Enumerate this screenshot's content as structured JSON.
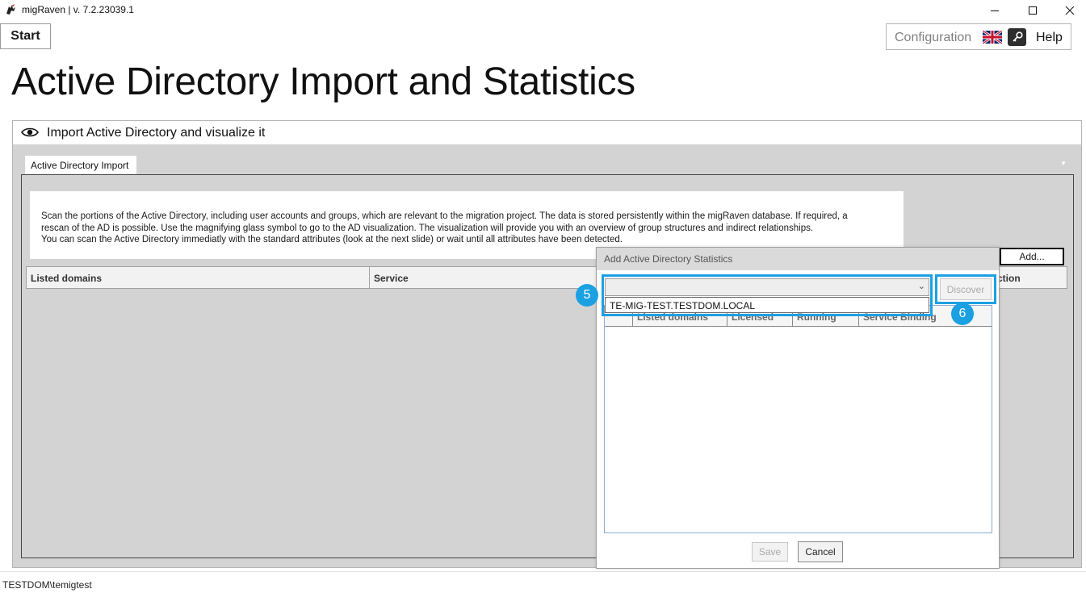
{
  "window": {
    "title": "migRaven | v. 7.2.23039.1",
    "icons": [
      "app-icon",
      "minimize-icon",
      "maximize-icon",
      "close-icon"
    ]
  },
  "toolbar": {
    "start_label": "Start",
    "configuration_label": "Configuration",
    "help_label": "Help",
    "language_icon": "uk-flag-icon",
    "license_icon": "key-icon"
  },
  "page": {
    "title": "Active Directory Import and Statistics"
  },
  "section": {
    "title": "Import Active Directory and visualize it",
    "icon": "eye-icon",
    "tab_label": "Active Directory Import",
    "info_lines": [
      "Scan the portions of the Active Directory, including user accounts and groups, which are relevant to the migration project. The data is stored persistently within the migRaven database. If required, a",
      "rescan of the AD is possible. Use the magnifying glass symbol to go to the AD visualization. The visualization will provide you with an overview of group structures and indirect relationships.",
      "You can scan the Active Directory immediatly with the standard attributes (look at the next slide) or wait until all attributes have been detected."
    ],
    "add_label": "Add...",
    "grid_columns": [
      "Listed domains",
      "Service",
      "ction"
    ]
  },
  "dialog": {
    "title": "Add Active Directory Statistics",
    "combo_value": "",
    "combo_option": "TE-MIG-TEST.TESTDOM.LOCAL",
    "discover_label": "Discover",
    "grid_columns": [
      "",
      "Listed domains",
      "Licensed",
      "Running",
      "Service Binding"
    ],
    "save_label": "Save",
    "cancel_label": "Cancel"
  },
  "annotations": {
    "badge5": "5",
    "badge6": "6",
    "accent_color": "#1ba1e2"
  },
  "status": {
    "user": "TESTDOM\\temigtest"
  }
}
